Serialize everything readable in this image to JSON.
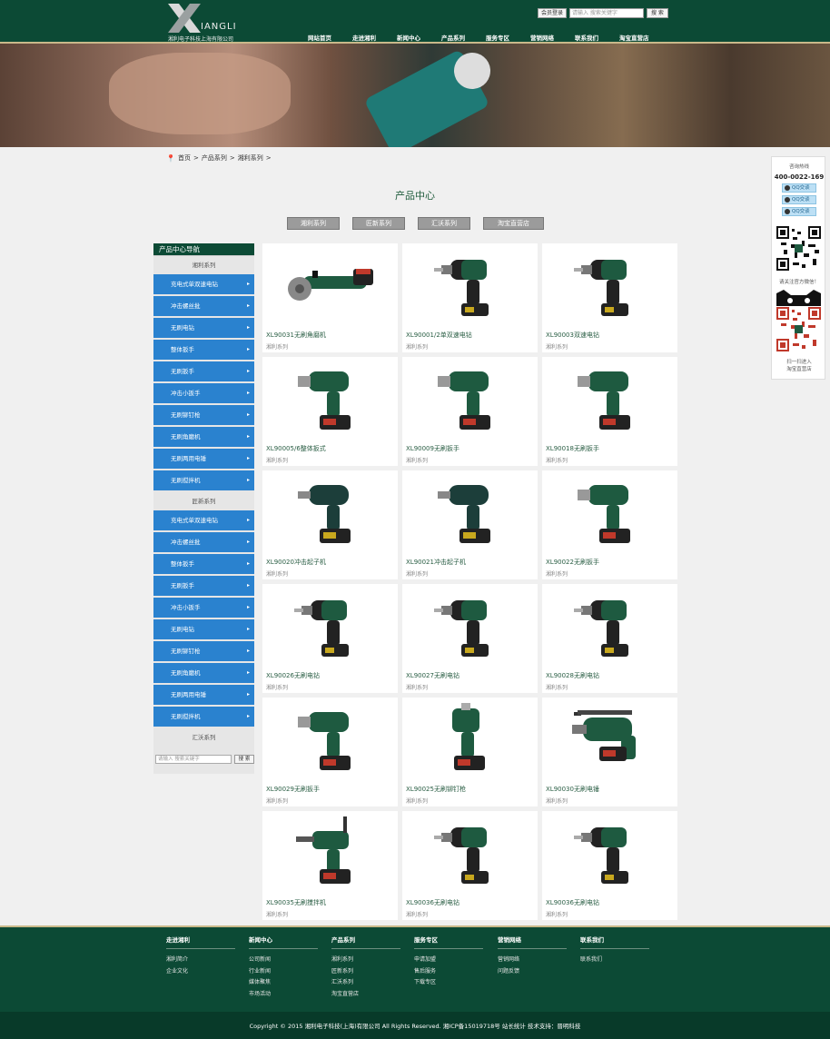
{
  "header": {
    "logo_word": "IANGLI",
    "logo_sub": "湘利电子科技上海有限公司",
    "login": "会员登录",
    "search_placeholder": "请输入 搜索关键字",
    "search_button": "搜 索",
    "nav": [
      "网站首页",
      "走进湘利",
      "新闻中心",
      "产品系列",
      "服务专区",
      "营销网络",
      "联系我们",
      "淘宝直营店"
    ]
  },
  "breadcrumb": [
    "首页",
    ">",
    "产品系列",
    ">",
    "湘利系列",
    ">"
  ],
  "page_title": "产品中心",
  "series_tabs": [
    "湘利系列",
    "匠新系列",
    "汇沃系列",
    "淘宝直营店"
  ],
  "sidebar": {
    "title": "产品中心导航",
    "groups": [
      {
        "name": "湘利系列",
        "items": [
          "充电式单双速电钻",
          "冲击螺丝批",
          "无刷电钻",
          "整体扳手",
          "无刷扳手",
          "冲击小扳手",
          "无刷铆钉枪",
          "无刷角磨机",
          "无刷两用电锤",
          "无刷搅拌机"
        ]
      },
      {
        "name": "匠新系列",
        "items": [
          "充电式单双速电钻",
          "冲击螺丝批",
          "整体扳手",
          "无刷扳手",
          "冲击小扳手",
          "无刷电钻",
          "无刷铆钉枪",
          "无刷角磨机",
          "无刷两用电锤",
          "无刷搅拌机"
        ]
      },
      {
        "name": "汇沃系列",
        "items": []
      }
    ],
    "search_placeholder": "请输入 搜索关键字",
    "search_button": "搜 索"
  },
  "products": [
    {
      "name": "XL90031无刷角磨机",
      "category": "湘利系列",
      "icon": "angle-grinder-icon"
    },
    {
      "name": "XL90001/2单双速电钻",
      "category": "湘利系列",
      "icon": "drill-icon"
    },
    {
      "name": "XL90003双速电钻",
      "category": "湘利系列",
      "icon": "drill-icon"
    },
    {
      "name": "XL90005/6整体扳式",
      "category": "湘利系列",
      "icon": "impact-wrench-icon"
    },
    {
      "name": "XL90009无刷扳手",
      "category": "湘利系列",
      "icon": "impact-wrench-icon"
    },
    {
      "name": "XL90018无刷扳手",
      "category": "湘利系列",
      "icon": "impact-wrench-icon"
    },
    {
      "name": "XL90020冲击起子机",
      "category": "湘利系列",
      "icon": "impact-driver-icon"
    },
    {
      "name": "XL90021冲击起子机",
      "category": "湘利系列",
      "icon": "impact-driver-icon"
    },
    {
      "name": "XL90022无刷扳手",
      "category": "湘利系列",
      "icon": "impact-wrench-icon"
    },
    {
      "name": "XL90026无刷电钻",
      "category": "湘利系列",
      "icon": "drill-icon"
    },
    {
      "name": "XL90027无刷电钻",
      "category": "湘利系列",
      "icon": "drill-icon"
    },
    {
      "name": "XL90028无刷电钻",
      "category": "湘利系列",
      "icon": "drill-icon"
    },
    {
      "name": "XL90029无刷扳手",
      "category": "湘利系列",
      "icon": "impact-wrench-icon"
    },
    {
      "name": "XL90025无刷铆钉枪",
      "category": "湘利系列",
      "icon": "rivet-gun-icon"
    },
    {
      "name": "XL90030无刷电锤",
      "category": "湘利系列",
      "icon": "rotary-hammer-icon"
    },
    {
      "name": "XL90035无刷搅拌机",
      "category": "湘利系列",
      "icon": "mixer-icon"
    },
    {
      "name": "XL90036无刷电钻",
      "category": "湘利系列",
      "icon": "drill-icon"
    },
    {
      "name": "XL90036无刷电钻",
      "category": "湘利系列",
      "icon": "drill-icon"
    }
  ],
  "right_panel": {
    "hotline_label": "咨询热线",
    "phone": "400-0022-169",
    "qq": [
      "QQ交谈",
      "QQ交谈",
      "QQ交谈"
    ],
    "wechat_caption": "请关注官方微信！",
    "taobao_caption_1": "扫一扫进入",
    "taobao_caption_2": "淘宝直营店"
  },
  "footer": {
    "columns": [
      {
        "title": "走进湘利",
        "links": [
          "湘利简介",
          "企业文化"
        ]
      },
      {
        "title": "新闻中心",
        "links": [
          "公司新闻",
          "行业新闻",
          "媒体聚焦",
          "市场活动"
        ]
      },
      {
        "title": "产品系列",
        "links": [
          "湘利系列",
          "匠新系列",
          "汇沃系列",
          "淘宝直营店"
        ]
      },
      {
        "title": "服务专区",
        "links": [
          "申请加盟",
          "售后服务",
          "下载专区"
        ]
      },
      {
        "title": "营销网络",
        "links": [
          "营销网络",
          "问题反馈"
        ]
      },
      {
        "title": "联系我们",
        "links": [
          "联系我们"
        ]
      }
    ],
    "copyright": "Copyright © 2015 湘利电子科技(上海)有限公司 All Rights Reserved. 湘ICP备15019718号 站长统计 技术支持：晋明科技"
  },
  "colors": {
    "brand_green": "#0c4a35",
    "gold_line": "#c9b98a",
    "sidebar_blue": "#2a82cf",
    "tool_green": "#1e5a40",
    "battery_red": "#c0392b"
  }
}
